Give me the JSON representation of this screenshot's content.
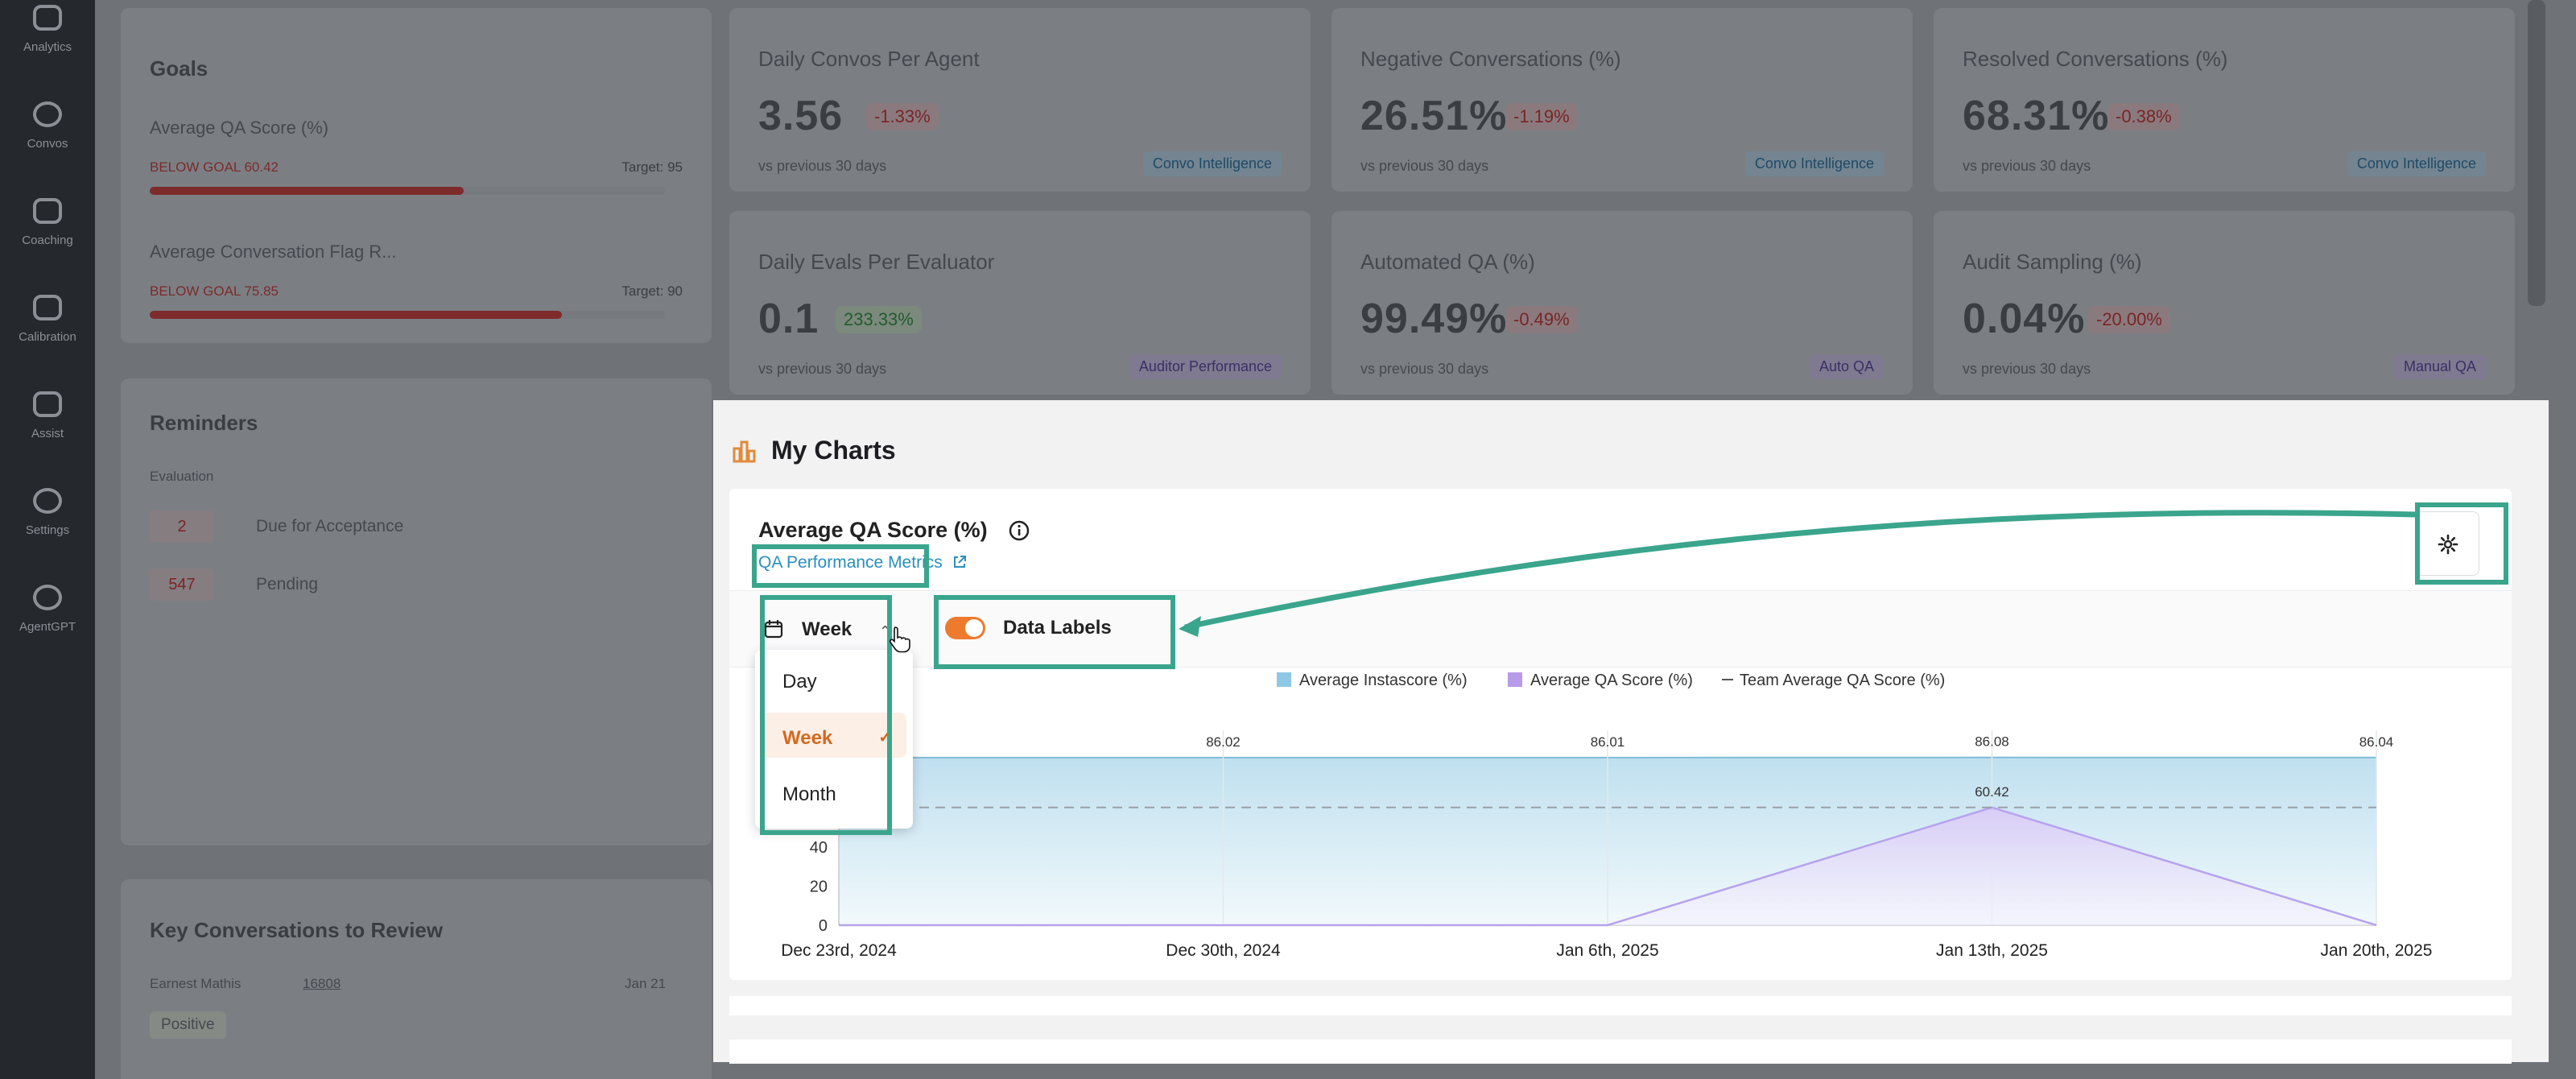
{
  "sidebar": {
    "items": [
      {
        "label": "Analytics",
        "icon": "home-icon"
      },
      {
        "label": "Convos",
        "icon": "chat-icon"
      },
      {
        "label": "Coaching",
        "icon": "clipboard-icon"
      },
      {
        "label": "Calibration",
        "icon": "calibration-icon"
      },
      {
        "label": "Assist",
        "icon": "monitor-icon"
      },
      {
        "label": "Settings",
        "icon": "gear-icon"
      },
      {
        "label": "AgentGPT",
        "icon": "agent-icon"
      }
    ]
  },
  "background": {
    "goals": {
      "title": "Goals",
      "items": [
        {
          "title": "Average QA Score (%)",
          "status": "BELOW GOAL 60.42",
          "target": "Target: 95",
          "progress": 0.61
        },
        {
          "title": "Average Conversation Flag R...",
          "status": "BELOW GOAL 75.85",
          "target": "Target: 90",
          "progress": 0.8
        }
      ]
    },
    "reminders": {
      "title": "Reminders",
      "section": "Evaluation",
      "items": [
        {
          "count": "2",
          "label": "Due for Acceptance"
        },
        {
          "count": "547",
          "label": "Pending"
        }
      ]
    },
    "key_conversations": {
      "title": "Key Conversations to Review",
      "row": {
        "agent": "Earnest Mathis",
        "id": "16808",
        "date": "Jan 21",
        "tag": "Positive"
      }
    },
    "stats": [
      {
        "title": "Daily Convos Per Agent",
        "value": "3.56",
        "delta": "-1.33%",
        "direction": "down",
        "foot": "vs previous 30 days",
        "tag": "Convo Intelligence",
        "tag_color": "blue"
      },
      {
        "title": "Negative Conversations (%)",
        "value": "26.51%",
        "delta": "-1.19%",
        "direction": "down",
        "foot": "vs previous 30 days",
        "tag": "Convo Intelligence",
        "tag_color": "blue"
      },
      {
        "title": "Resolved Conversations (%)",
        "value": "68.31%",
        "delta": "-0.38%",
        "direction": "down",
        "foot": "vs previous 30 days",
        "tag": "Convo Intelligence",
        "tag_color": "blue"
      },
      {
        "title": "Daily Evals Per Evaluator",
        "value": "0.1",
        "delta": "233.33%",
        "direction": "up",
        "foot": "vs previous 30 days",
        "tag": "Auditor Performance",
        "tag_color": "purple"
      },
      {
        "title": "Automated QA (%)",
        "value": "99.49%",
        "delta": "-0.49%",
        "direction": "down",
        "foot": "vs previous 30 days",
        "tag": "Auto QA",
        "tag_color": "purple"
      },
      {
        "title": "Audit Sampling (%)",
        "value": "0.04%",
        "delta": "-20.00%",
        "direction": "down",
        "foot": "vs previous 30 days",
        "tag": "Manual QA",
        "tag_color": "purple"
      }
    ]
  },
  "my_charts": {
    "title": "My Charts",
    "chart_title": "Average QA Score (%)",
    "link_label": "QA Performance Metrics",
    "timeframe": "Week",
    "toggle_label": "Data Labels",
    "toggle_on": true,
    "dropdown_options": [
      "Day",
      "Week",
      "Month"
    ],
    "dropdown_selected": "Week",
    "accent_color": "#ee7a2e",
    "highlight_color": "#3aa58c"
  },
  "chart_data": {
    "type": "area",
    "x": [
      "Dec 23rd, 2024",
      "Dec 30th, 2024",
      "Jan 6th, 2025",
      "Jan 13th, 2025",
      "Jan 20th, 2025"
    ],
    "series": [
      {
        "name": "Average Instascore (%)",
        "color": "#8ec8e4",
        "values": [
          86.0,
          86.02,
          86.01,
          86.08,
          86.04
        ],
        "labels": [
          "",
          "86.02",
          "86.01",
          "86.08",
          "86.04"
        ]
      },
      {
        "name": "Average QA Score (%)",
        "color": "#b79ae8",
        "values": [
          0,
          0,
          0,
          60.42,
          0
        ],
        "labels": [
          "",
          "",
          "",
          "60.42",
          ""
        ]
      }
    ],
    "reference_lines": [
      {
        "name": "Team Average QA Score (%)",
        "value": 60.42
      }
    ],
    "ylim": [
      0,
      100
    ],
    "yticks": [
      "0",
      "20",
      "40"
    ],
    "legend": "top-center"
  }
}
